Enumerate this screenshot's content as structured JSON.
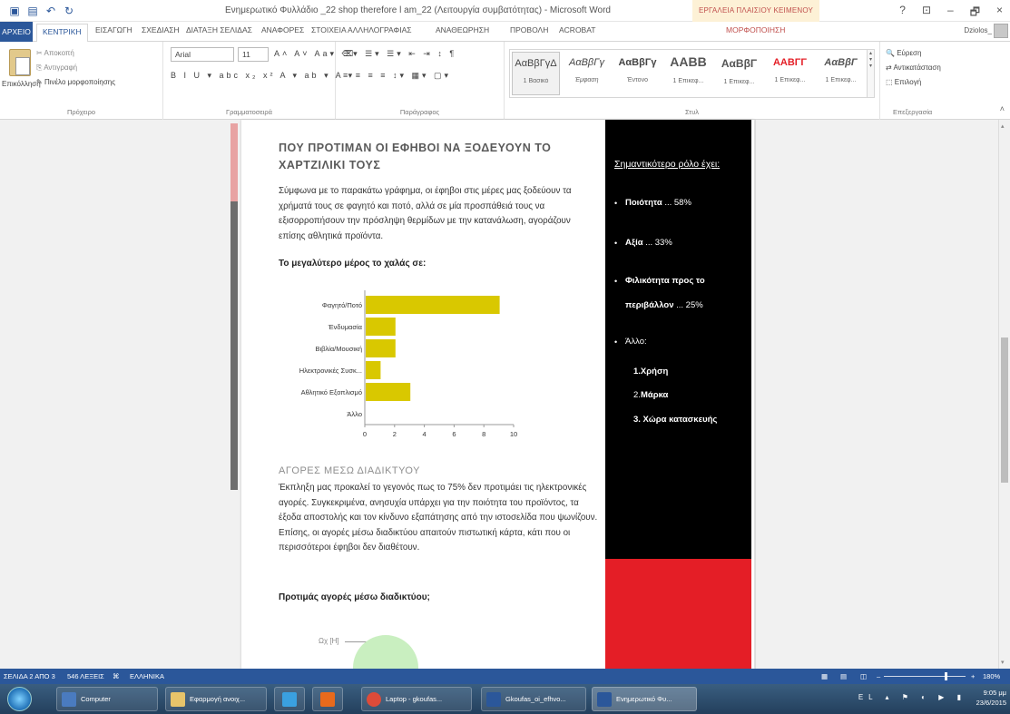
{
  "titlebar": {
    "title": "Ενημερωτικό Φυλλάδιο _22 shop therefore l am_22 (Λειτουργία συμβατότητας) - Microsoft Word",
    "context_group": "ΕΡΓΑΛΕΙΑ ΠΛΑΙΣΙΟΥ ΚΕΙΜΕΝΟΥ",
    "buttons": {
      "help": "?",
      "ribbon_opts": "⊡",
      "min": "–",
      "max": "🗗",
      "close": "×"
    }
  },
  "tabs": {
    "file": "ΑΡΧΕΙΟ",
    "items": [
      "ΚΕΝΤΡΙΚΗ",
      "ΕΙΣΑΓΩΓΗ",
      "ΣΧΕΔΙΑΣΗ",
      "ΔΙΑΤΑΞΗ ΣΕΛΙΔΑΣ",
      "ΑΝΑΦΟΡΕΣ",
      "ΣΤΟΙΧΕΙΑ ΑΛΛΗΛΟΓΡΑΦΙΑΣ",
      "ΑΝΑΘΕΩΡΗΣΗ",
      "ΠΡΟΒΟΛΗ",
      "ACROBAT"
    ],
    "context_tab": "ΜΟΡΦΟΠΟΙΗΣΗ",
    "user": "Dziolos_"
  },
  "ribbon": {
    "clipboard": {
      "paste": "Επικόλληση",
      "cut": "Αποκοπή",
      "copy": "Αντιγραφή",
      "format_painter": "Πινέλο μορφοποίησης",
      "label": "Πρόχειρο"
    },
    "font": {
      "name": "Arial",
      "size": "11",
      "label": "Γραμματοσειρά",
      "row1": "A˄ A˅ Aa▾ ⌫",
      "row2": "B I U ▾ abc x₂ x² A ▾ ab ▾ A ▾"
    },
    "paragraph": {
      "label": "Παράγραφος",
      "row1": "☰▾ ☰▾ ☰▾ ⇤ ⇥ ↕ ¶",
      "row2": "≡ ≡ ≡ ≡ ↕▾ ▦▾ ▢▾"
    },
    "styles": {
      "label": "Στυλ",
      "items": [
        {
          "sample": "ΑαΒβΓγΔ",
          "name": "1 Βασικό"
        },
        {
          "sample": "ΑαΒβΓγ",
          "name": "Έμφαση"
        },
        {
          "sample": "ΑαΒβΓγ",
          "name": "Έντονο"
        },
        {
          "sample": "ΑΑΒΒ",
          "name": "1 Επικεφ..."
        },
        {
          "sample": "ΑαΒβΓ",
          "name": "1 Επικεφ..."
        },
        {
          "sample": "ΑΑΒΓΓ",
          "name": "1 Επικεφ..."
        },
        {
          "sample": "ΑαΒβΓ",
          "name": "1 Επικεφ..."
        }
      ]
    },
    "editing": {
      "find": "Εύρεση",
      "replace": "Αντικατάσταση",
      "select": "Επιλογή",
      "label": "Επεξεργασία"
    }
  },
  "document": {
    "heading": "ΠΟΥ ΠΡΟΤΙΜΑΝ ΟΙ ΕΦΗΒΟΙ ΝΑ ΞΟΔΕΥΟΥΝ ΤΟ ΧΑΡΤΖΙΛΙΚΙ ΤΟΥΣ",
    "intro": "Σύμφωνα με το παρακάτω γράφημα, οι έφηβοι στις μέρες μας ξοδεύουν τα χρήματά τους σε φαγητό και ποτό, αλλά σε μία προσπάθειά τους να εξισορροπήσουν την πρόσληψη θερμίδων με την κατανάλωση, αγοράζουν επίσης αθλητικά προϊόντα.",
    "chart_heading": "Το μεγαλύτερο μέρος το χαλάς σε:",
    "section2_heading": "ΑΓΟΡΕΣ ΜΕΣΩ ΔΙΑΔΙΚΤΥΟΥ",
    "section2_text": "Έκπληξη μας προκαλεί το γεγονός πως το 75% δεν προτιμάει τις ηλεκτρονικές αγορές. Συγκεκριμένα, ανησυχία υπάρχει για την ποιότητα του προϊόντος, τα έξοδα αποστολής και τον κίνδυνο εξαπάτησης από την ιστοσελίδα που ψωνίζουν. Επίσης, οι αγορές μέσω διαδικτύου απαιτούν πιστωτική κάρτα, κάτι που οι περισσότεροι έφηβοι δεν διαθέτουν.",
    "pie_heading": "Προτιμάς αγορές μέσω διαδικτύου;",
    "pie_label": "Ωχ [Η]",
    "sidebar": {
      "header": "Σημαντικότερο ρόλο έχει:",
      "items": [
        {
          "bold": "Ποιότητα",
          "rest": " ... 58%"
        },
        {
          "bold": "Αξία",
          "rest": " ... 33%"
        },
        {
          "bold": "Φιλικότητα προς το",
          "rest": ""
        },
        {
          "bold": "περιβάλλον",
          "rest": " ... 25%"
        },
        {
          "bold": "",
          "rest": "Άλλο:"
        },
        {
          "bold": "",
          "rest": "1.Χρήση"
        },
        {
          "bold": "Μάρκα",
          "rest": "2."
        },
        {
          "bold": "",
          "rest": "3. Χώρα κατασκευής"
        }
      ]
    }
  },
  "chart_data": {
    "type": "bar",
    "orientation": "horizontal",
    "categories": [
      "Φαγητό/Ποτό",
      "Ένδυμασία",
      "Βιβλία/Μουσική",
      "Ηλεκτρονικές Συσκ...",
      "Αθλητικό Εξοπλισμό",
      "Άλλο"
    ],
    "values": [
      9,
      2,
      2,
      1,
      3,
      0
    ],
    "xlim": [
      0,
      10
    ],
    "xticks": [
      "0",
      "2",
      "4",
      "6",
      "8",
      "10"
    ],
    "color": "#d9c800"
  },
  "statusbar": {
    "page": "ΣΕΛΙΔΑ 2 ΑΠΟ 3",
    "words": "546 ΛΕΞΕΙΣ",
    "lang": "ΕΛΛΗΝΙΚΑ",
    "zoom": "180%"
  },
  "taskbar": {
    "items": [
      "Computer",
      "Εφαρμογή ανοιχ...",
      "",
      "",
      "Laptop - gkoufas...",
      "Gkoufas_oi_efhvo...",
      "Ενημερωτικό Φυ..."
    ],
    "lang": "EL",
    "time": "9:05 μμ",
    "date": "23/6/2015"
  }
}
